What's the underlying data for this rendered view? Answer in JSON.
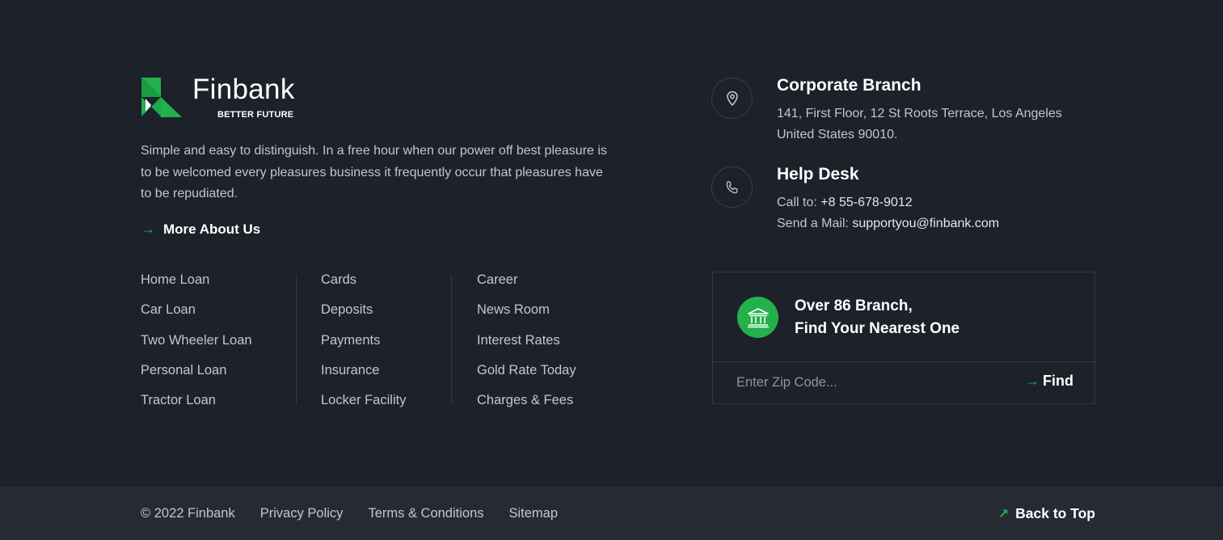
{
  "brand": {
    "name": "Finbank",
    "tagline": "BETTER FUTURE",
    "accent_color": "#22b14c"
  },
  "about": {
    "text": "Simple and easy to distinguish. In a free hour when our power off best pleasure is to be welcomed every pleasures business it frequently occur that pleasures have to be repudiated.",
    "more_label": "More About Us",
    "more_icon": "arrow-right-icon"
  },
  "links": {
    "col1": [
      "Home Loan",
      "Car Loan",
      "Two Wheeler Loan",
      "Personal Loan",
      "Tractor Loan"
    ],
    "col2": [
      "Cards",
      "Deposits",
      "Payments",
      "Insurance",
      "Locker Facility"
    ],
    "col3": [
      "Career",
      "News Room",
      "Interest Rates",
      "Gold Rate Today",
      "Charges & Fees"
    ]
  },
  "contact": {
    "branch": {
      "icon": "location-pin-icon",
      "title": "Corporate Branch",
      "line1": "141, First Floor, 12 St Roots Terrace, Los Angeles",
      "line2": "United States 90010."
    },
    "helpdesk": {
      "icon": "phone-icon",
      "title": "Help Desk",
      "call_prefix": "Call to: ",
      "phone": "+8 55-678-9012",
      "mail_prefix": "Send a Mail: ",
      "email": "supportyou@finbank.com"
    }
  },
  "branch_finder": {
    "icon": "bank-icon",
    "line1": "Over 86 Branch,",
    "line2": "Find Your Nearest One",
    "input_placeholder": "Enter Zip Code...",
    "find_label": "Find"
  },
  "bottom": {
    "copyright": "© 2022 Finbank",
    "privacy": "Privacy Policy",
    "terms": "Terms & Conditions",
    "sitemap": "Sitemap",
    "back_to_top": "Back to Top"
  }
}
